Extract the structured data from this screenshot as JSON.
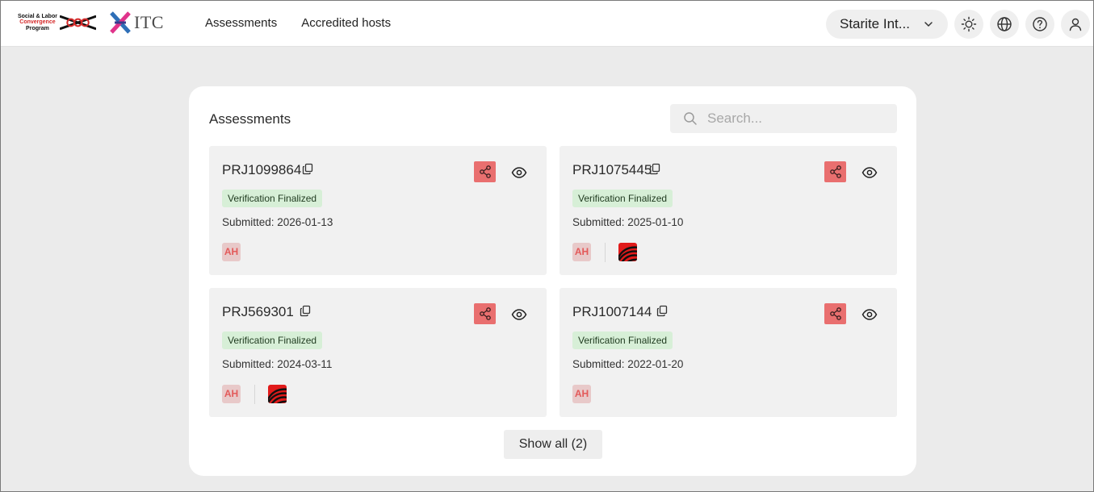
{
  "header": {
    "slcp_logo": {
      "line1": "Social & Labor",
      "line2": "Convergence",
      "line3": "Program"
    },
    "itc_logo": {
      "text": "ITC"
    },
    "nav": [
      "Assessments",
      "Accredited hosts"
    ],
    "org_select": {
      "value": "Starite Int..."
    },
    "icons": [
      "sun-icon",
      "globe-icon",
      "help-icon",
      "user-icon"
    ]
  },
  "panel": {
    "title": "Assessments",
    "search": {
      "placeholder": "Search...",
      "value": ""
    },
    "cards": [
      {
        "id": "PRJ1099864",
        "status": "Verification Finalized",
        "submitted": "Submitted: 2026-01-13",
        "avatar": "AH",
        "host_logo": false
      },
      {
        "id": "PRJ1075445",
        "status": "Verification Finalized",
        "submitted": "Submitted: 2025-01-10",
        "avatar": "AH",
        "host_logo": true
      },
      {
        "id": "PRJ569301",
        "status": "Verification Finalized",
        "submitted": "Submitted: 2024-03-11",
        "avatar": "AH",
        "host_logo": true
      },
      {
        "id": "PRJ1007144",
        "status": "Verification Finalized",
        "submitted": "Submitted: 2022-01-20",
        "avatar": "AH",
        "host_logo": false
      }
    ],
    "show_all_label": "Show all (2)"
  },
  "colors": {
    "accent_red": "#e96f6f",
    "badge_green": "#d7efd7",
    "avatar_bg": "#e8c9c9",
    "avatar_text": "#e35a5a",
    "page_bg": "#ebebeb"
  }
}
